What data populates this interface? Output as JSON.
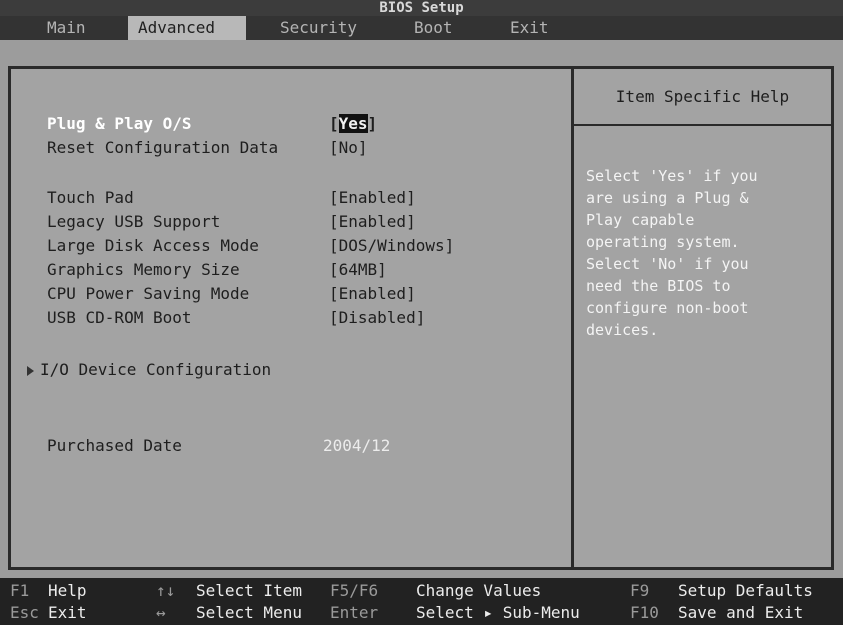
{
  "title": "BIOS Setup",
  "menu": {
    "tabs": [
      {
        "label": "Main"
      },
      {
        "label": "Advanced"
      },
      {
        "label": "Security"
      },
      {
        "label": "Boot"
      },
      {
        "label": "Exit"
      }
    ],
    "active": "Advanced"
  },
  "settings": {
    "plug_play": {
      "label": "Plug & Play O/S",
      "value": "Yes",
      "open": "[",
      "close": "]"
    },
    "reset_config": {
      "label": "Reset Configuration Data",
      "value": "[No]"
    },
    "touch_pad": {
      "label": "Touch Pad",
      "value": "[Enabled]"
    },
    "legacy_usb": {
      "label": "Legacy USB Support",
      "value": "[Enabled]"
    },
    "large_disk": {
      "label": "Large Disk Access Mode",
      "value": "[DOS/Windows]"
    },
    "graphics_mem": {
      "label": "Graphics Memory Size",
      "value": "[64MB]"
    },
    "cpu_power": {
      "label": "CPU Power Saving Mode",
      "value": "[Enabled]"
    },
    "usb_cdrom": {
      "label": "USB CD-ROM Boot",
      "value": "[Disabled]"
    },
    "io_device": {
      "label": "I/O Device Configuration"
    },
    "purchased": {
      "label": "Purchased Date",
      "value": "2004/12"
    }
  },
  "help": {
    "title": "Item Specific Help",
    "text": "Select 'Yes' if you\nare using a Plug &\nPlay capable\noperating system.\nSelect 'No' if you\nneed the BIOS to\nconfigure non-boot\ndevices."
  },
  "footer": {
    "f1_key": "F1",
    "f1_desc": "Help",
    "esc_key": "Esc",
    "esc_desc": "Exit",
    "updown_key": "↑↓",
    "updown_desc": "Select Item",
    "leftright_key": "↔",
    "leftright_desc": "Select Menu",
    "f5f6_key": "F5/F6",
    "f5f6_desc": "Change Values",
    "enter_key": "Enter",
    "enter_desc": "Select ▸ Sub-Menu",
    "f9_key": "F9",
    "f9_desc": "Setup Defaults",
    "f10_key": "F10",
    "f10_desc": "Save and Exit"
  }
}
